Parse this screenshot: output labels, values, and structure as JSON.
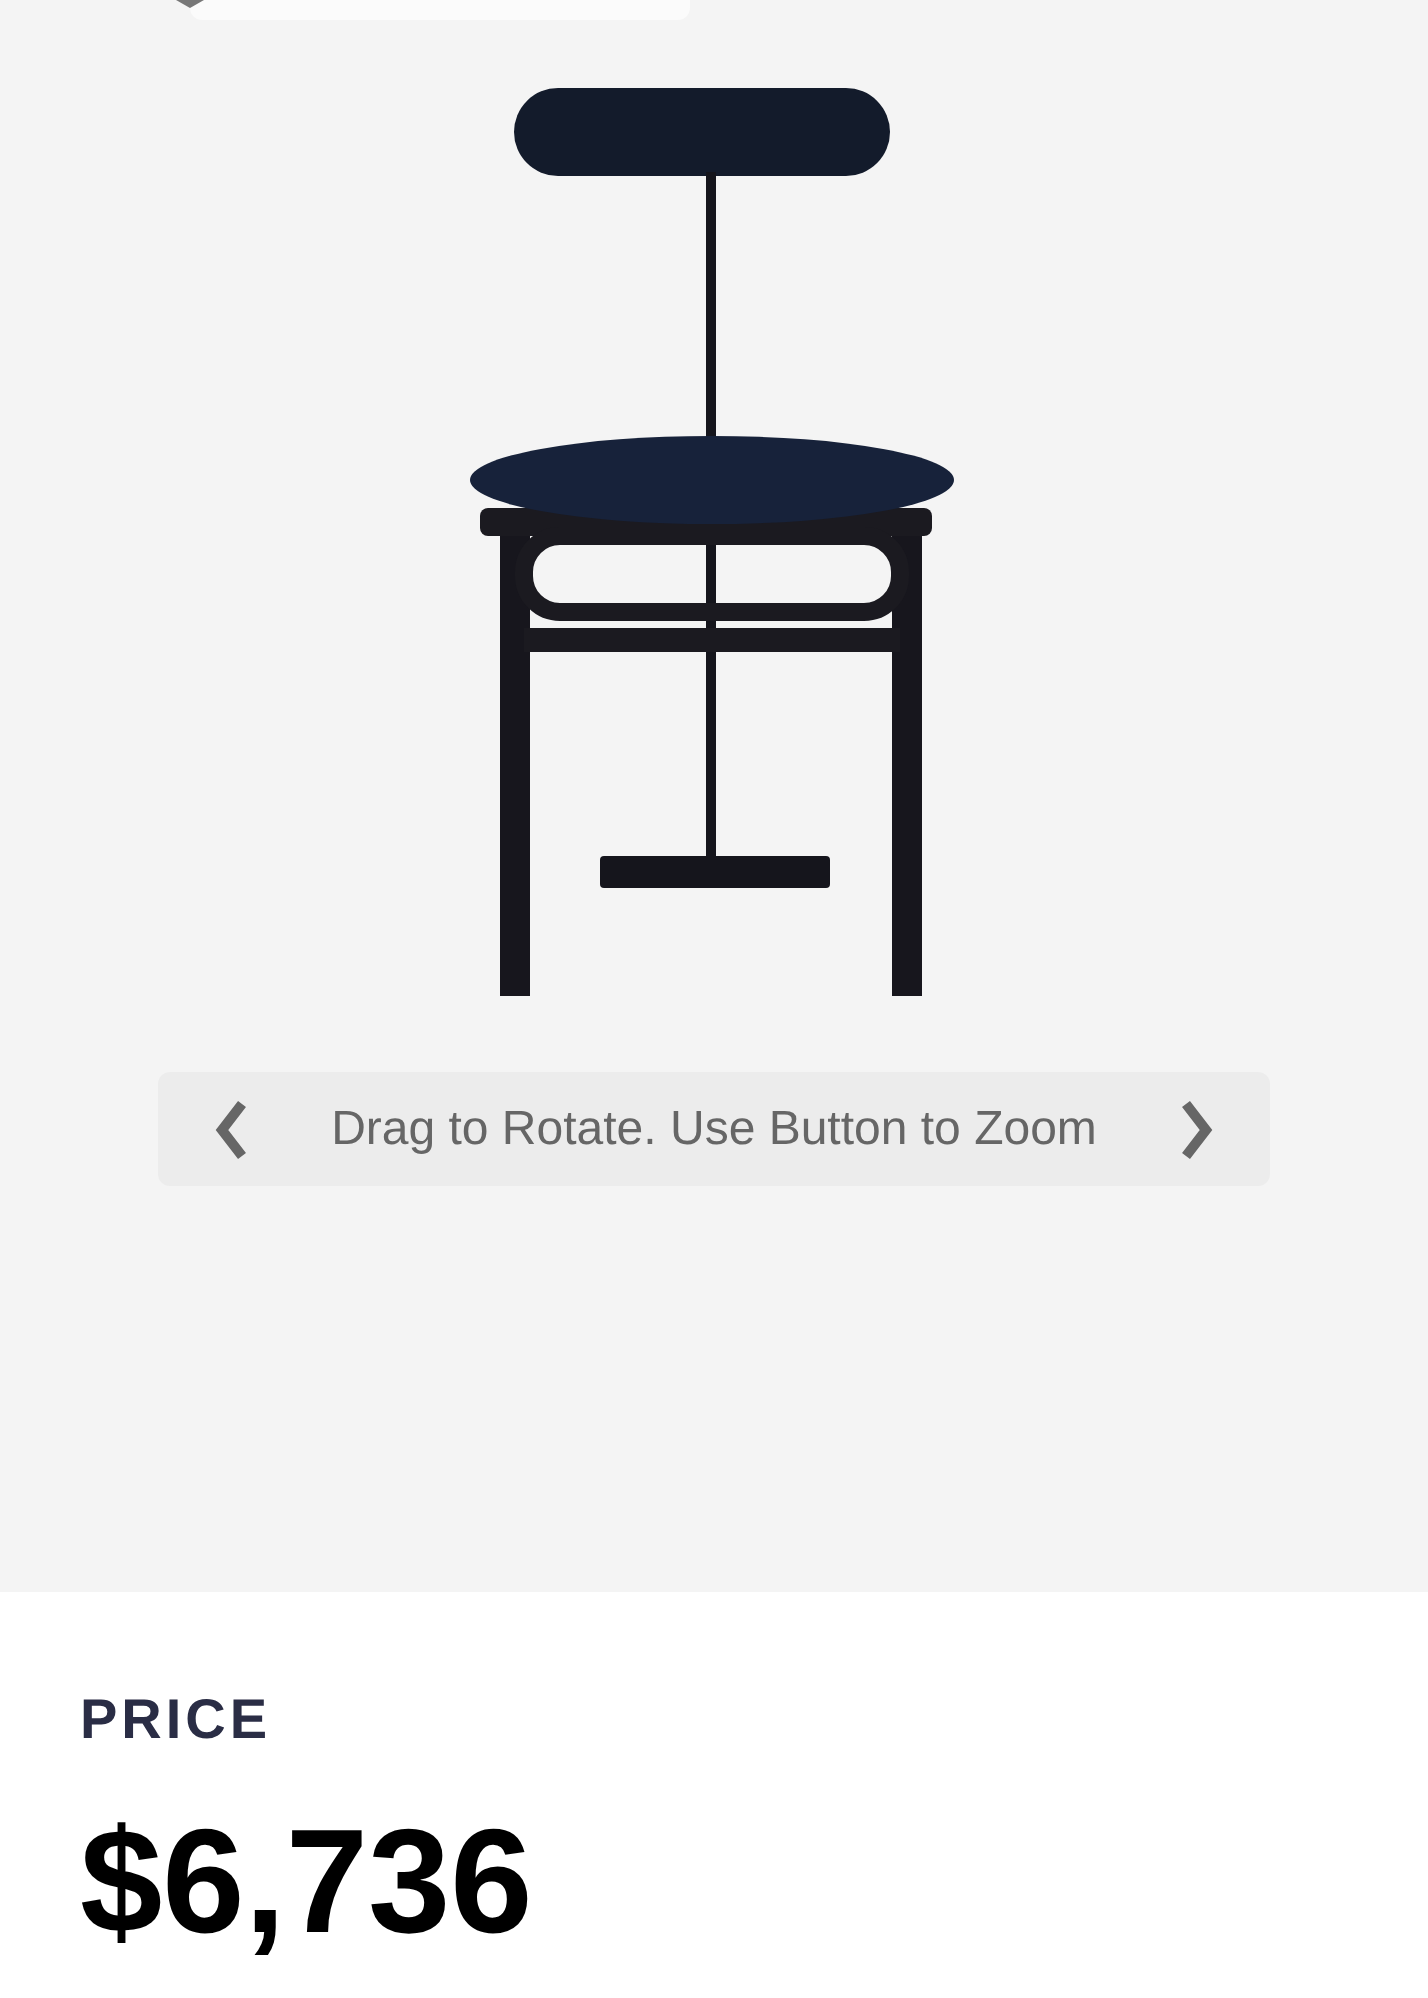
{
  "viewer": {
    "hint": "Drag to Rotate. Use Button to Zoom"
  },
  "price": {
    "label": "PRICE",
    "amount": "$6,736"
  }
}
